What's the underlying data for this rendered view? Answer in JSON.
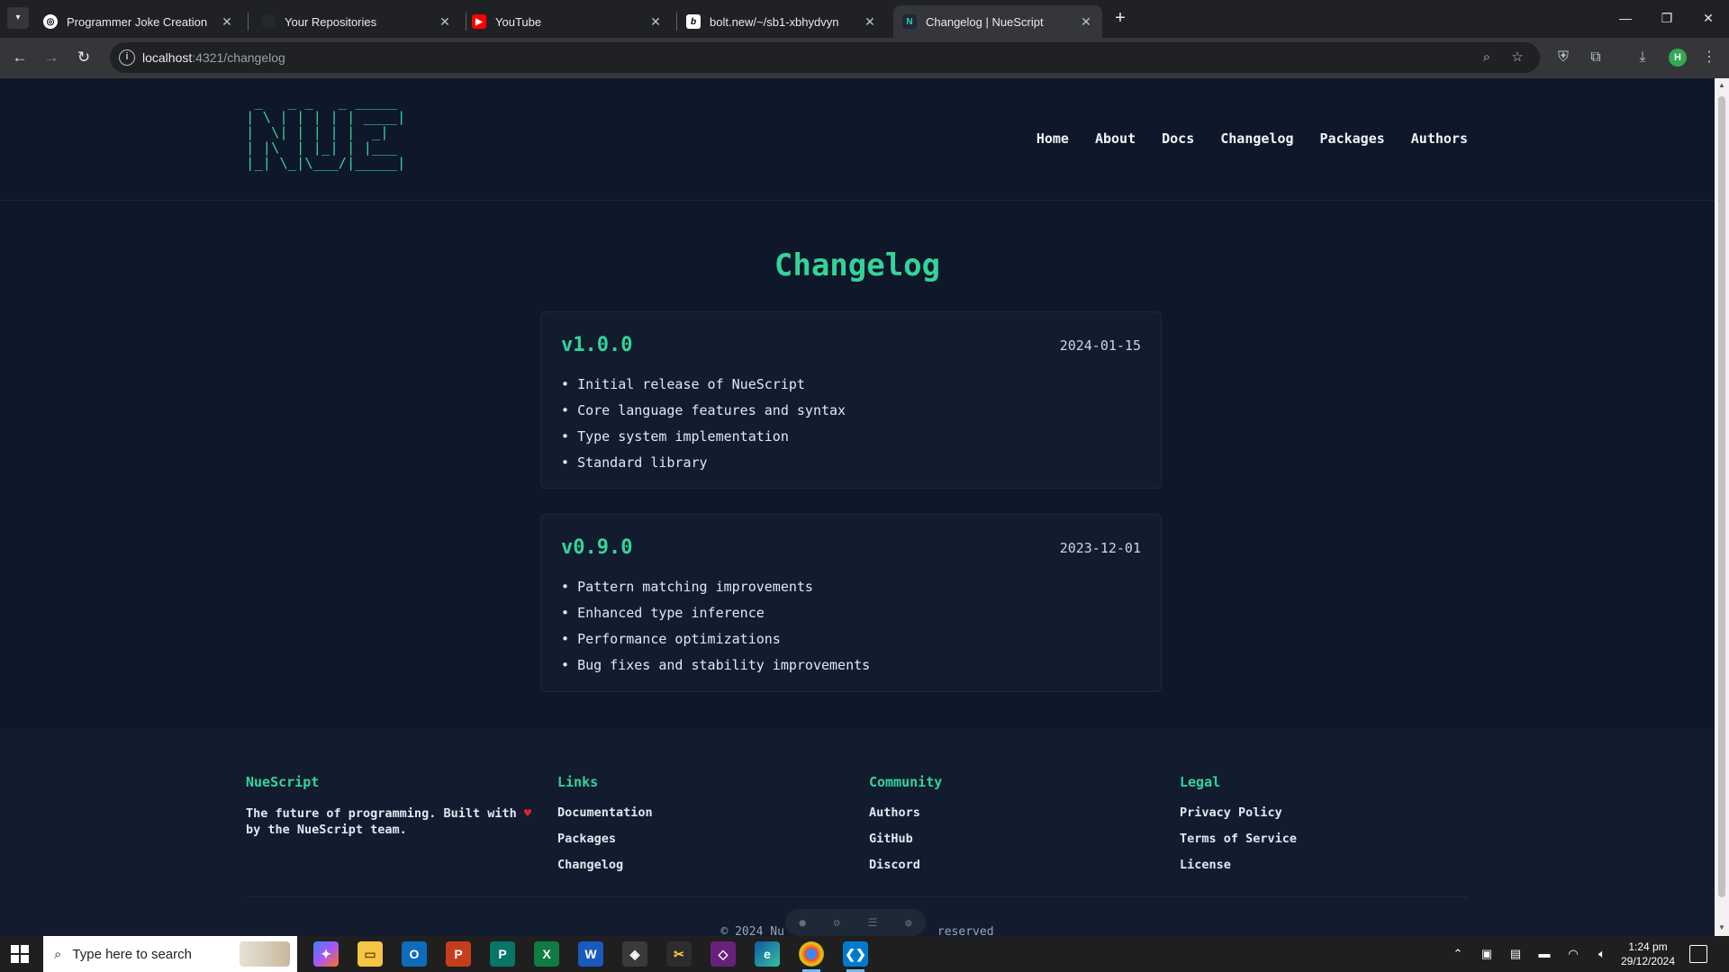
{
  "browser": {
    "tabs": [
      {
        "title": "Programmer Joke Creation",
        "icon": "chatgpt-icon"
      },
      {
        "title": "Your Repositories",
        "icon": "github-icon"
      },
      {
        "title": "YouTube",
        "icon": "youtube-icon"
      },
      {
        "title": "bolt.new/~/sb1-xbhydvyn",
        "icon": "bolt-icon"
      },
      {
        "title": "Changelog | NueScript",
        "icon": "nuescript-icon",
        "active": true
      }
    ],
    "url_host": "localhost",
    "url_path": ":4321/changelog",
    "profile_initial": "H"
  },
  "site": {
    "logo_ascii": " _   _ _   _ _____\n| \\ | | | | | ____|\n|  \\| | | | |  _|\n| |\\  | |_| | |___\n|_| \\_|\\___/|_____|",
    "nav": [
      "Home",
      "About",
      "Docs",
      "Changelog",
      "Packages",
      "Authors"
    ],
    "page_title": "Changelog",
    "releases": [
      {
        "version": "v1.0.0",
        "date": "2024-01-15",
        "items": [
          "Initial release of NueScript",
          "Core language features and syntax",
          "Type system implementation",
          "Standard library"
        ]
      },
      {
        "version": "v0.9.0",
        "date": "2023-12-01",
        "items": [
          "Pattern matching improvements",
          "Enhanced type inference",
          "Performance optimizations",
          "Bug fixes and stability improvements"
        ]
      }
    ],
    "footer": {
      "brand": {
        "title": "NueScript",
        "text_before": "The future of programming. Built with",
        "text_after": "by the NueScript team."
      },
      "links": {
        "title": "Links",
        "items": [
          "Documentation",
          "Packages",
          "Changelog"
        ]
      },
      "community": {
        "title": "Community",
        "items": [
          "Authors",
          "GitHub",
          "Discord"
        ]
      },
      "legal": {
        "title": "Legal",
        "items": [
          "Privacy Policy",
          "Terms of Service",
          "License"
        ]
      },
      "copyright_left": "© 2024 Nu",
      "copyright_right": "reserved"
    },
    "accent_color": "#34d399"
  },
  "taskbar": {
    "search_placeholder": "Type here to search",
    "time": "1:24 pm",
    "date": "29/12/2024"
  }
}
